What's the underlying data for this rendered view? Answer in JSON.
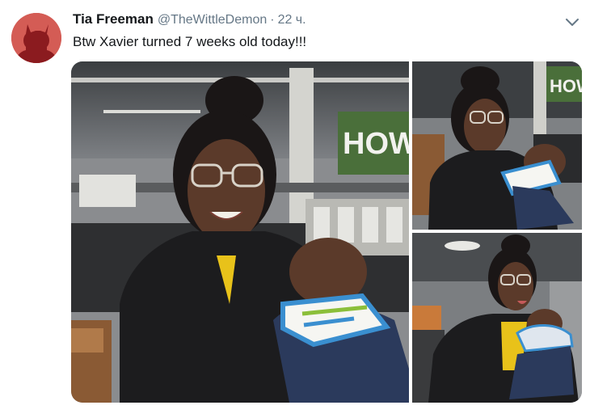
{
  "tweet": {
    "author_name": "Tia Freeman",
    "author_handle": "@TheWittleDemon",
    "separator": "·",
    "timestamp": "22 ч.",
    "text": "Btw Xavier turned 7 weeks old today!!!"
  },
  "avatar": {
    "icon": "devil-silhouette-icon",
    "background": "#d45c55",
    "figure_color": "#8b1b1f"
  },
  "menu": {
    "icon": "chevron-down-icon"
  },
  "photos": {
    "photo1": {
      "store_sign": "HOW"
    },
    "photo2": {
      "store_sign": "HOW"
    },
    "photo3": {}
  },
  "colors": {
    "name": "#14171a",
    "secondary_text": "#657786",
    "jacket": "#1c1c1e",
    "bib": "#3a8fd0"
  }
}
